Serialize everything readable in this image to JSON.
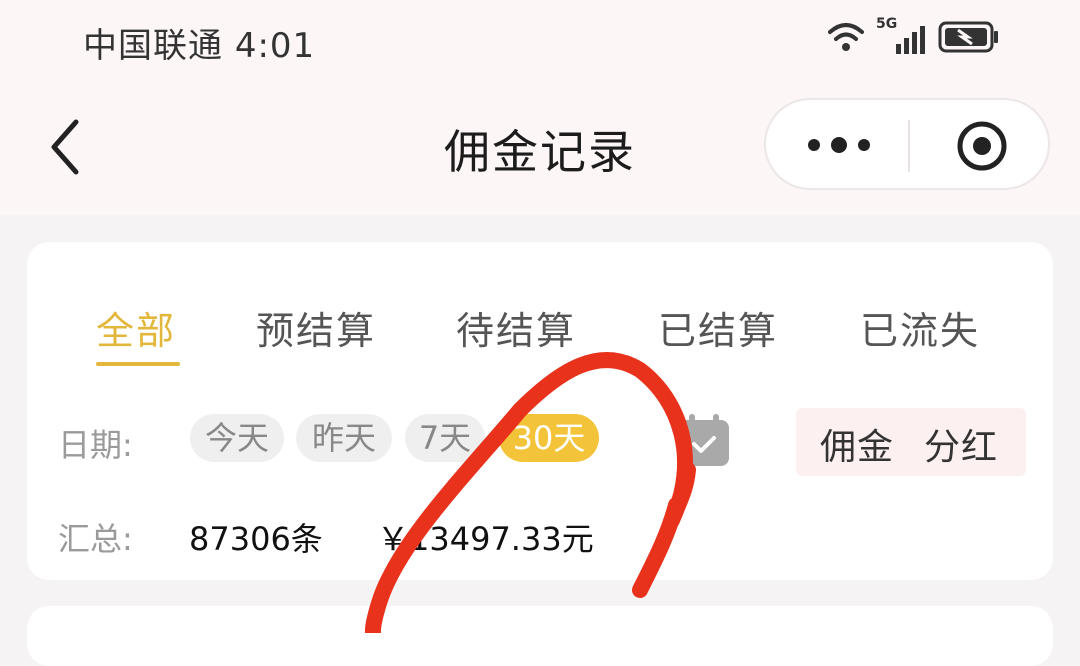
{
  "status_bar": {
    "carrier": "中国联通",
    "time": "4:01",
    "network": "5G"
  },
  "nav": {
    "title": "佣金记录"
  },
  "tabs": [
    {
      "label": "全部",
      "active": true
    },
    {
      "label": "预结算",
      "active": false
    },
    {
      "label": "待结算",
      "active": false
    },
    {
      "label": "已结算",
      "active": false
    },
    {
      "label": "已流失",
      "active": false
    }
  ],
  "date_filter": {
    "label": "日期:",
    "options": [
      {
        "label": "今天",
        "active": false
      },
      {
        "label": "昨天",
        "active": false
      },
      {
        "label": "7天",
        "active": false
      },
      {
        "label": "30天",
        "active": true
      }
    ]
  },
  "type_toggle": {
    "options": [
      "佣金",
      "分红"
    ]
  },
  "summary": {
    "label": "汇总:",
    "count": "87306条",
    "amount": "￥13497.33元"
  },
  "colors": {
    "accent": "#e3b73c",
    "chip_active": "#f3c43a",
    "scribble": "#e8321c"
  }
}
